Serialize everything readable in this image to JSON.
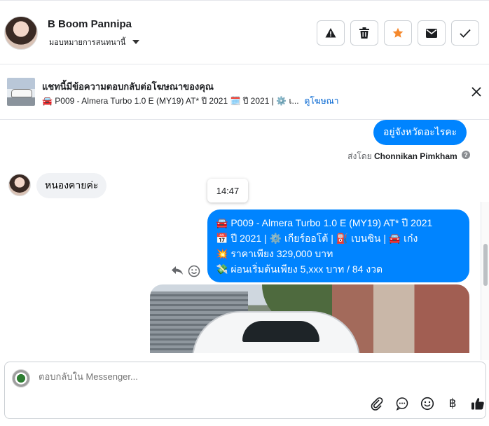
{
  "header": {
    "contact_name": "B Boom Pannipa",
    "assign_label": "มอบหมายการสนทนานี้",
    "actions": [
      "warning-icon",
      "trash-icon",
      "star-icon",
      "mail-icon",
      "check-icon"
    ],
    "star_color": "#f5882c"
  },
  "ad": {
    "title": "แชทนี้มีข้อความตอบกลับต่อโฆษณาของคุณ",
    "subtitle": "🚘 P009 - Almera Turbo 1.0 E (MY19) AT* ปี 2021 🗓️ ปี 2021 | ⚙️ เ...",
    "link": "ดูโฆษณา"
  },
  "messages": {
    "out_1": "อยู่จังหวัดอะไรคะ",
    "sent_by_prefix": "ส่งโดย",
    "sent_by_name": "Chonnikan Pimkham",
    "in_1": "หนองคายค่ะ",
    "timestamp": "14:47",
    "out_2_lines": [
      "🚘 P009 -  Almera Turbo 1.0 E (MY19) AT* ปี 2021",
      "📅 ปี 2021 | ⚙️ เกียร์ออโต้ | ⛽ เบนซิน | 🚘 เก๋ง",
      "💥 ราคาเพียง 329,000 บาท",
      "💸 ผ่อนเริ่มต้นเพียง 5,xxx บาท / 84 งวด"
    ],
    "bubble_color": "#0084ff"
  },
  "composer": {
    "placeholder": "ตอบกลับใน Messenger...",
    "tools": [
      "paperclip-icon",
      "chat-bubble-icon",
      "emoji-icon",
      "baht-icon",
      "thumbs-up-icon"
    ],
    "baht_symbol": "฿"
  }
}
